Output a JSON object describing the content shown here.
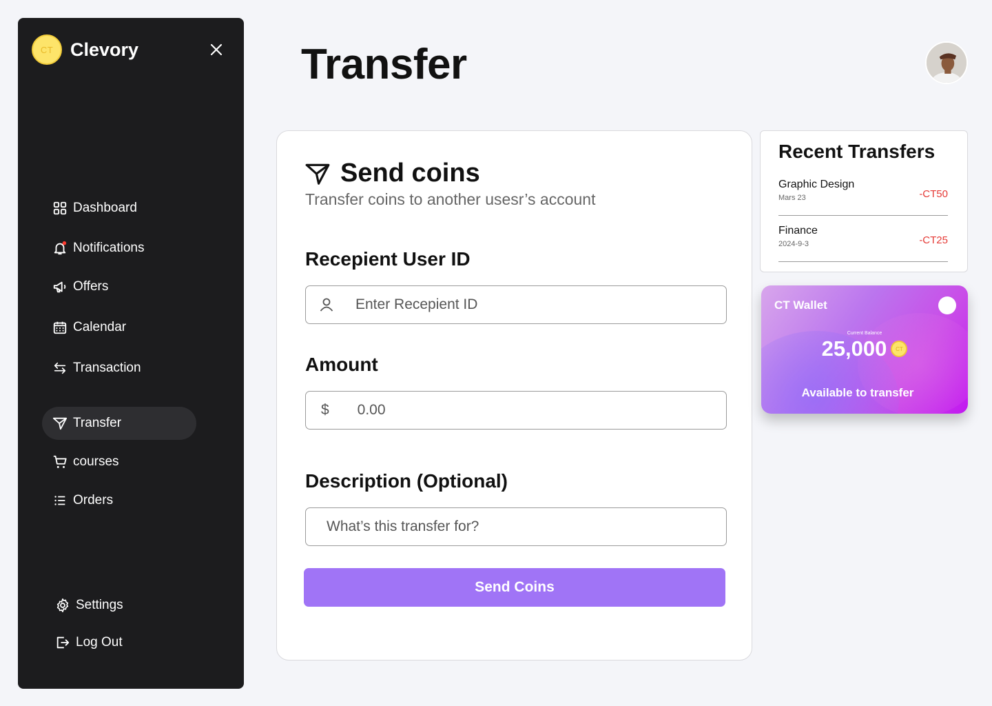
{
  "brand": {
    "logo_text": "CT",
    "name": "Clevory"
  },
  "sidebar": {
    "items": [
      {
        "label": "Dashboard",
        "icon": "grid-icon"
      },
      {
        "label": "Notifications",
        "icon": "bell-icon"
      },
      {
        "label": "Offers",
        "icon": "megaphone-icon"
      },
      {
        "label": "Calendar",
        "icon": "calendar-icon"
      },
      {
        "label": "Transaction",
        "icon": "arrows-icon"
      },
      {
        "label": "Transfer",
        "icon": "send-icon",
        "active": true
      },
      {
        "label": "courses",
        "icon": "cart-icon"
      },
      {
        "label": "Orders",
        "icon": "list-icon"
      }
    ],
    "bottom": [
      {
        "label": "Settings",
        "icon": "gear-icon"
      },
      {
        "label": "Log Out",
        "icon": "logout-icon"
      }
    ]
  },
  "header": {
    "title": "Transfer"
  },
  "form": {
    "title": "Send coins",
    "subtitle": "Transfer coins to another usesr’s account",
    "recipient_label": "Recepient User ID",
    "recipient_placeholder": "Enter Recepient ID",
    "amount_label": "Amount",
    "amount_prefix": "$",
    "amount_placeholder": "0.00",
    "description_label": "Description (Optional)",
    "description_placeholder": "What’s this transfer for?",
    "submit_label": "Send Coins"
  },
  "recent": {
    "title": "Recent Transfers",
    "items": [
      {
        "name": "Graphic Design",
        "date": "Mars 23",
        "amount": "-CT50"
      },
      {
        "name": "Finance",
        "date": "2024-9-3",
        "amount": "-CT25"
      }
    ]
  },
  "wallet": {
    "name": "CT Wallet",
    "balance_label": "Current Balance",
    "balance": "25,000",
    "coin_text": "CT",
    "available_label": "Available to transfer"
  },
  "colors": {
    "accent": "#a074f6",
    "sidebar": "#1c1c1e",
    "negative": "#e53935"
  }
}
